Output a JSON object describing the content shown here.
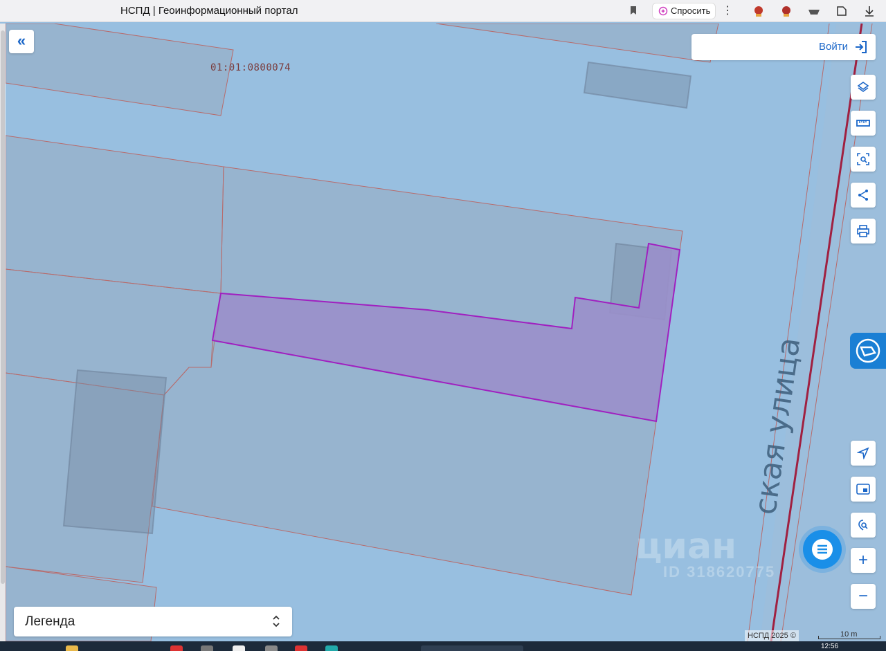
{
  "browser": {
    "tab_title": "НСПД | Геоинформационный портал",
    "ask_label": "Спросить",
    "kebab": "⋮"
  },
  "map": {
    "parcel_label": "01:01:0800074",
    "street_label": "ская улица",
    "watermark_logo": "циан",
    "watermark_id": "ID 318620775"
  },
  "toolbar": {
    "collapse": "«",
    "login_label": "Войти",
    "tools": [
      {
        "name": "layers-icon"
      },
      {
        "name": "ruler-icon"
      },
      {
        "name": "select-area-icon"
      },
      {
        "name": "share-icon"
      },
      {
        "name": "print-icon"
      }
    ],
    "lower_tools": [
      {
        "name": "geolocation-icon"
      },
      {
        "name": "minimap-icon"
      },
      {
        "name": "search-location-icon"
      }
    ],
    "zoom_in": "+",
    "zoom_out": "−"
  },
  "legend": {
    "label": "Легенда",
    "chevron": "⌃⌄"
  },
  "footer": {
    "attribution": "НСПД 2025 ©",
    "scale": "10 m",
    "clock": "12:56"
  },
  "colors": {
    "accent": "#1a66c8",
    "map_bg": "#98bfe0",
    "parcel_fill": "#9a8fca",
    "parcel_stroke": "#a020c0",
    "boundary": "#b06060"
  }
}
